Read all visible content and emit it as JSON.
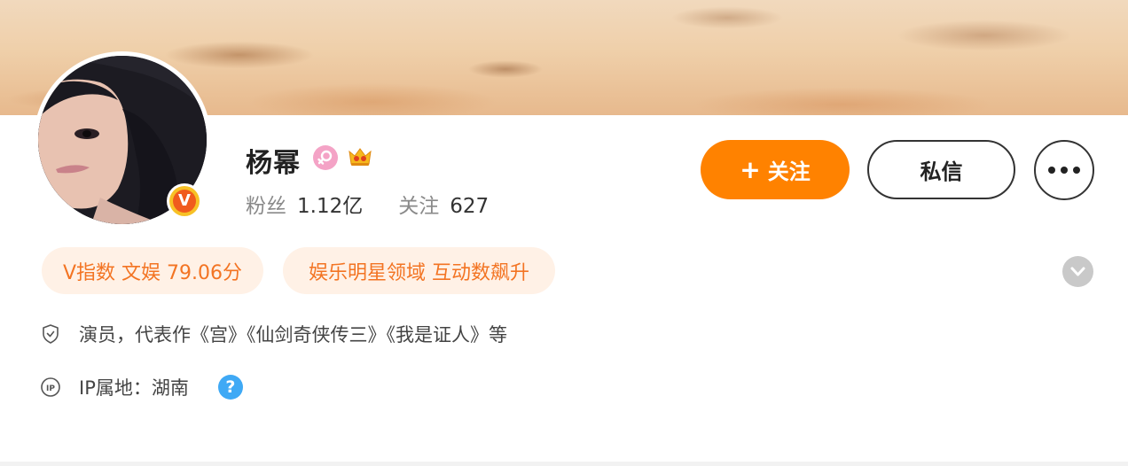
{
  "profile": {
    "name": "杨幂",
    "gender_icon": "female-icon",
    "badge_icon": "crown-icon",
    "verified_icon": "v-verified-icon",
    "verified_letter": "V"
  },
  "stats": {
    "fans_label": "粉丝",
    "fans_value": "1.12亿",
    "following_label": "关注",
    "following_value": "627"
  },
  "actions": {
    "follow_plus": "+",
    "follow_label": "关注",
    "message_label": "私信",
    "more_icon": "more-dots-icon"
  },
  "tags": [
    {
      "label": "V指数 文娱 79.06分"
    },
    {
      "label": "娱乐明星领域 互动数飙升"
    }
  ],
  "info": {
    "bio": "演员，代表作《宫》《仙剑奇侠传三》《我是证人》等",
    "bio_icon": "shield-check-icon",
    "ip_label": "IP属地：湖南",
    "ip_icon": "ip-icon",
    "help_icon": "question-mark-icon",
    "help_symbol": "?"
  },
  "colors": {
    "accent_orange": "#ff8200",
    "tag_bg": "#fff1e6",
    "tag_text": "#f37423",
    "verified_orange": "#f05b1d",
    "help_blue": "#3fa9f5"
  }
}
